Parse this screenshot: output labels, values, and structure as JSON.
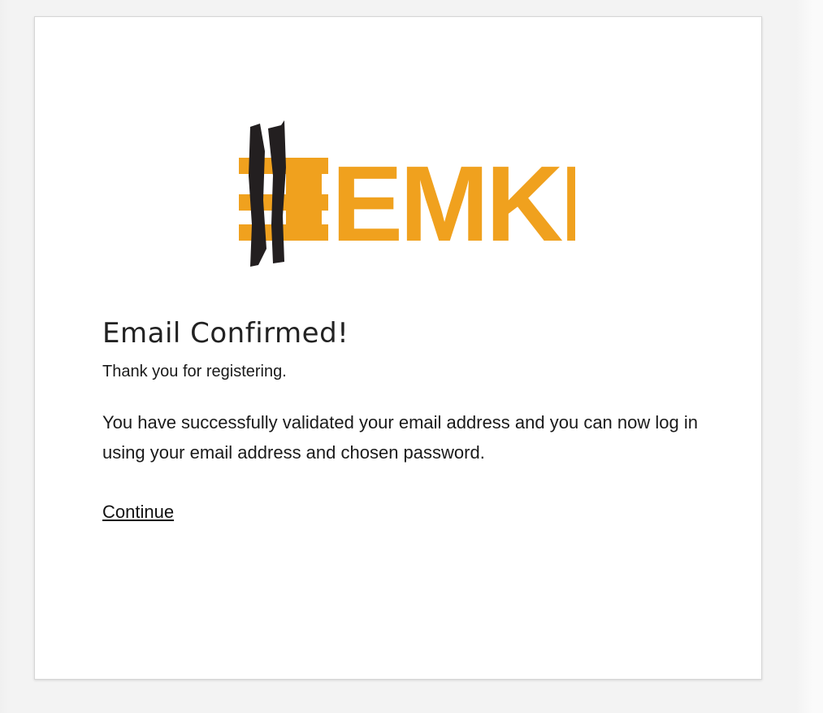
{
  "brand": {
    "logo_text": "EMKP",
    "accent_color": "#f0a11e",
    "stroke_color": "#231f20"
  },
  "confirmation": {
    "title": "Email Confirmed!",
    "thanks": "Thank you for registering.",
    "message": "You have successfully validated your email address and you can now log in using your email address and chosen password.",
    "continue_label": "Continue"
  }
}
